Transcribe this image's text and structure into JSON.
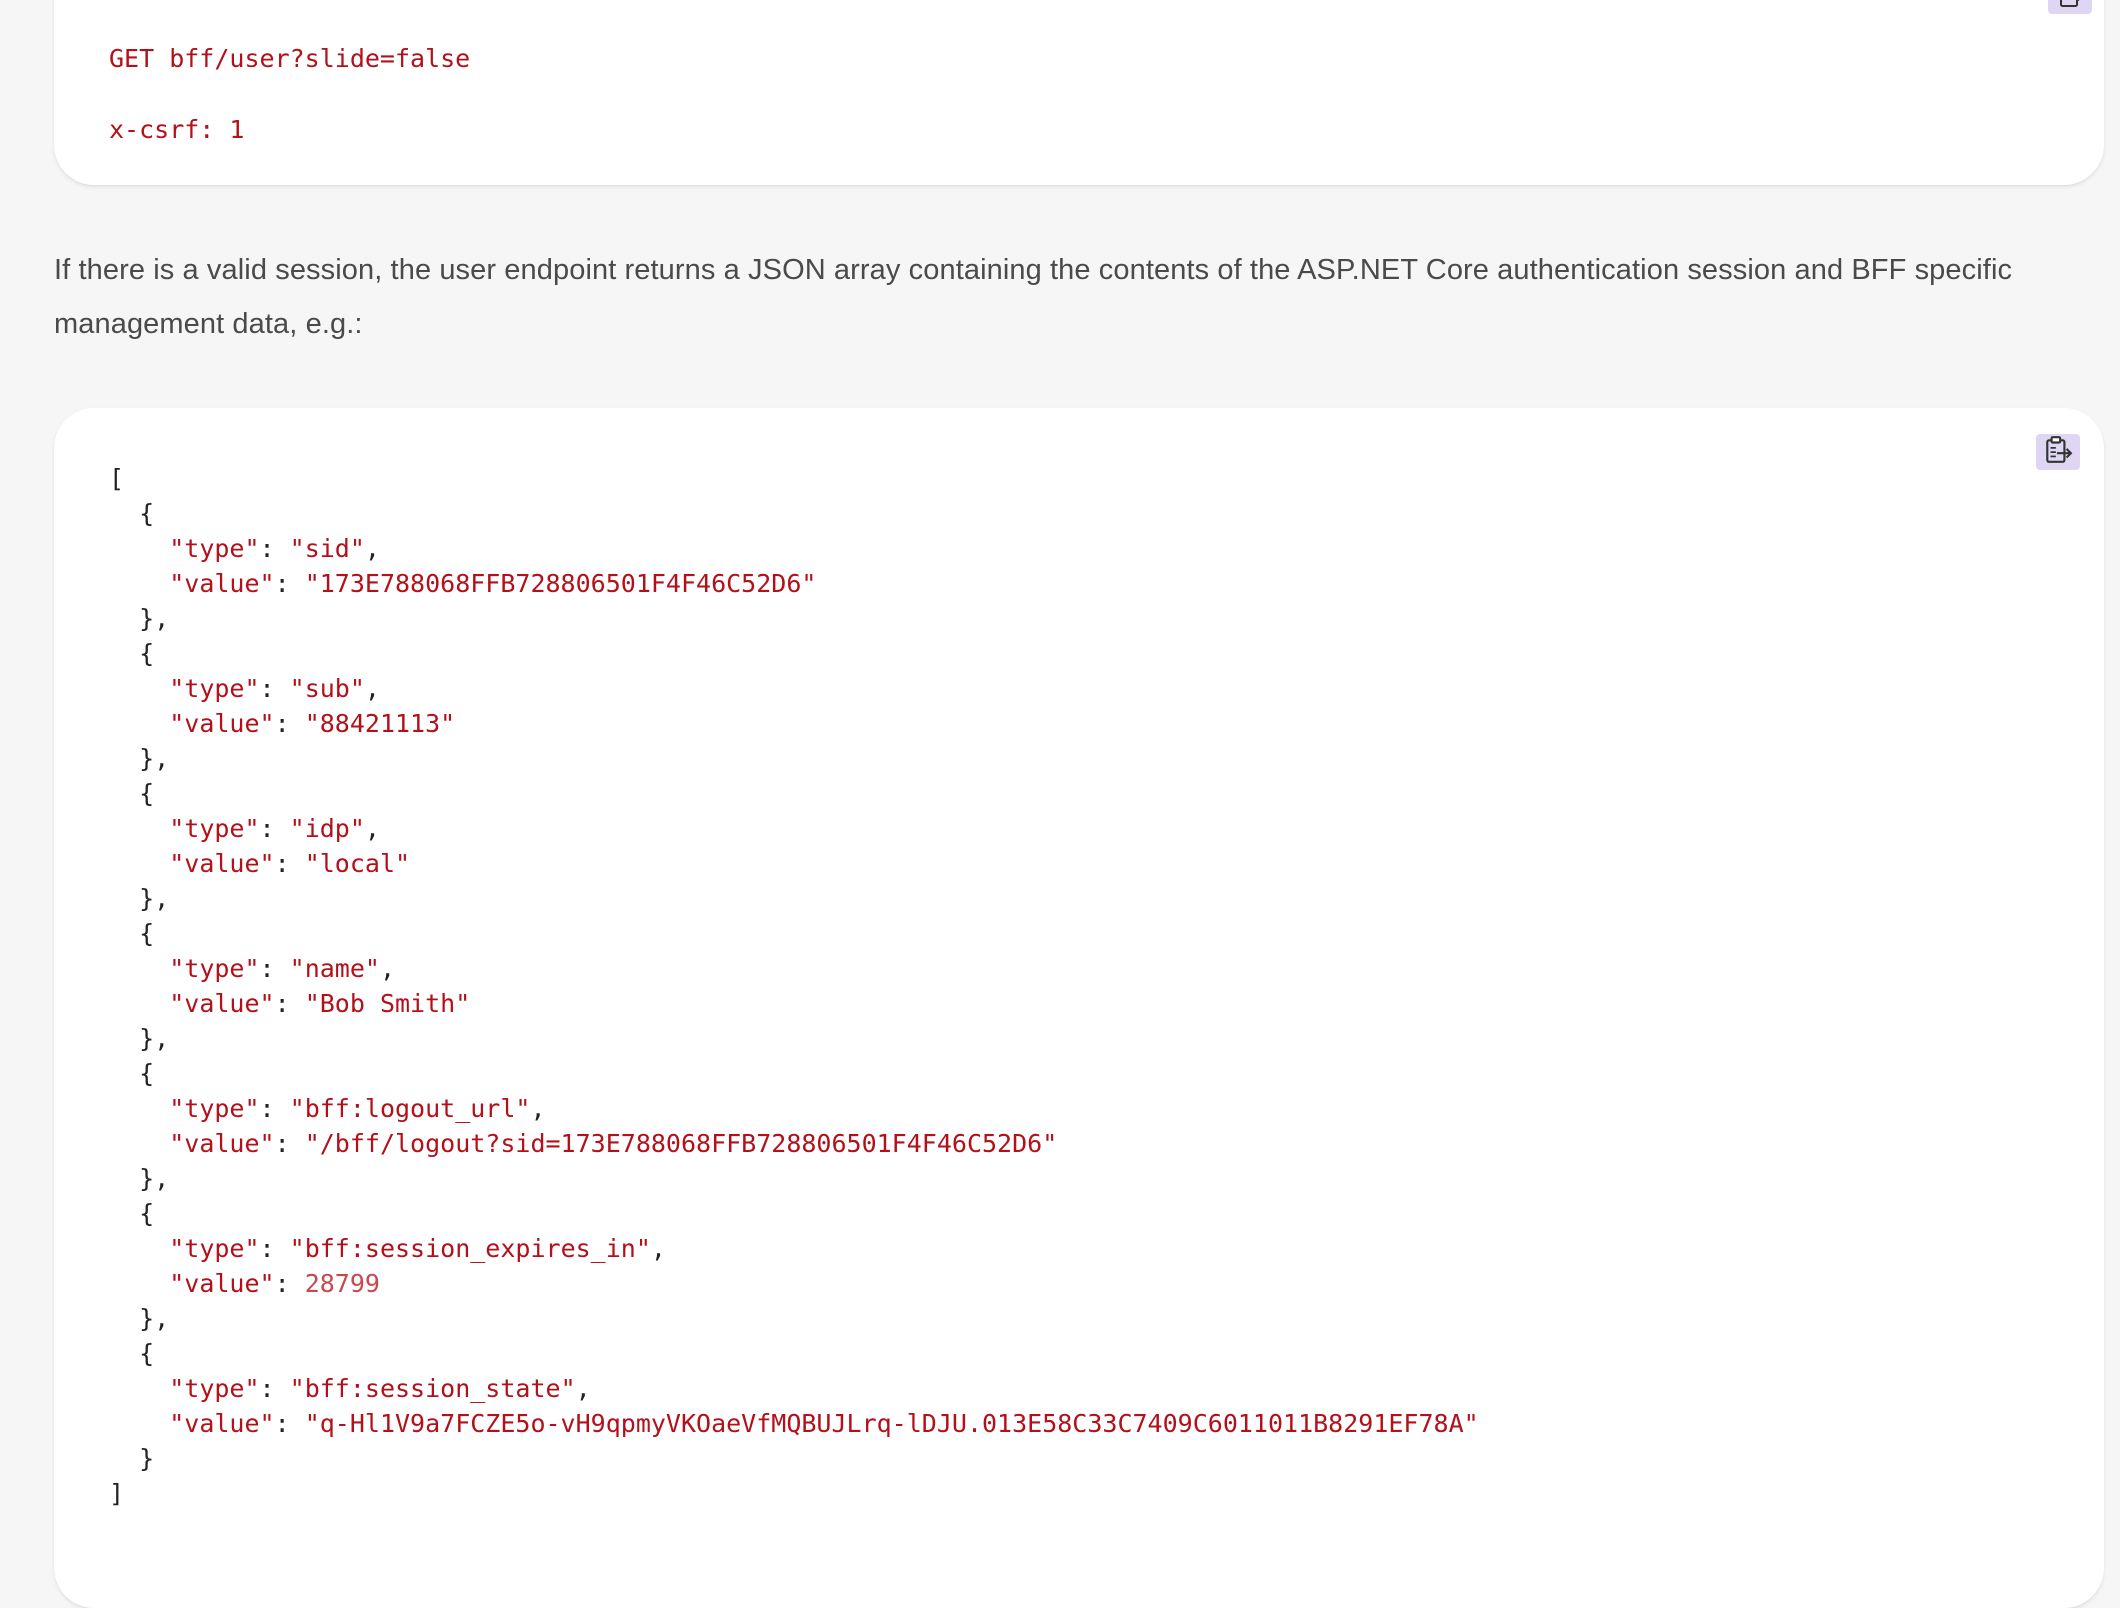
{
  "request_block": {
    "line1": "GET bff/user?slide=false",
    "line2": "x-csrf: 1",
    "copy_icon": "clipboard-copy-icon"
  },
  "paragraph": {
    "text": "If there is a valid session, the user endpoint returns a JSON array containing the contents of the ASP.NET Core authentication session and BFF specific management data, e.g.:"
  },
  "response_block": {
    "copy_icon": "clipboard-copy-icon",
    "open_bracket": "[",
    "close_bracket": "]",
    "entries": [
      {
        "type": "sid",
        "value": "173E788068FFB728806501F4F46C52D6",
        "value_is_number": false
      },
      {
        "type": "sub",
        "value": "88421113",
        "value_is_number": false
      },
      {
        "type": "idp",
        "value": "local",
        "value_is_number": false
      },
      {
        "type": "name",
        "value": "Bob Smith",
        "value_is_number": false
      },
      {
        "type": "bff:logout_url",
        "value": "/bff/logout?sid=173E788068FFB728806501F4F46C52D6",
        "value_is_number": false
      },
      {
        "type": "bff:session_expires_in",
        "value": "28799",
        "value_is_number": true
      },
      {
        "type": "bff:session_state",
        "value": "q-Hl1V9a7FCZE5o-vH9qpmyVKOaeVfMQBUJLrq-lDJU.013E58C33C7409C6011011B8291EF78A",
        "value_is_number": false
      }
    ]
  },
  "colors": {
    "page_bg": "#f6f6f6",
    "card_bg": "#ffffff",
    "code_red": "#b3101a",
    "number_red": "#c8484f",
    "punct": "#222222",
    "prose_text": "#4a4a4a",
    "copy_button_bg": "#ded6f2"
  }
}
